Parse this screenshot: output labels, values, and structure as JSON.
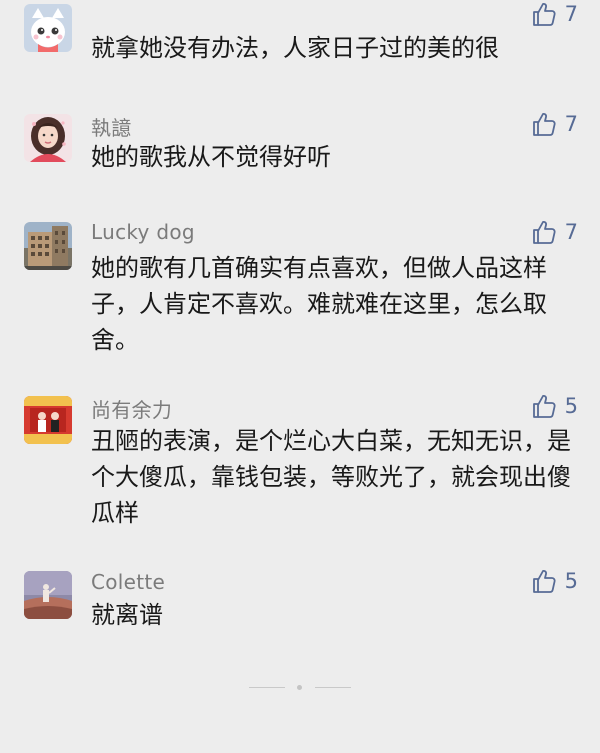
{
  "colors": {
    "background": "#ededed",
    "name_text": "#7b7b7b",
    "body_text": "#191919",
    "like_accent": "#576b95"
  },
  "comments": [
    {
      "name": "",
      "text": "就拿她没有办法，人家日子过的美的很",
      "likes": "7",
      "avatar_icon": "white-cat-avatar"
    },
    {
      "name": "執譩",
      "text": "她的歌我从不觉得好听",
      "likes": "7",
      "avatar_icon": "girl-portrait-avatar"
    },
    {
      "name": "Lucky dog",
      "text": "她的歌有几首确实有点喜欢，但做人品这样子，人肯定不喜欢。难就难在这里，怎么取舍。",
      "likes": "7",
      "avatar_icon": "building-photo-avatar"
    },
    {
      "name": "尚有余力",
      "text": "丑陋的表演，是个烂心大白菜，无知无识，是个大傻瓜，靠钱包装，等败光了，就会现出傻瓜样",
      "likes": "5",
      "avatar_icon": "red-stage-avatar"
    },
    {
      "name": "Colette",
      "text": "就离谱",
      "likes": "5",
      "avatar_icon": "landscape-figure-avatar"
    }
  ],
  "like_icon": "thumbs-up-icon"
}
